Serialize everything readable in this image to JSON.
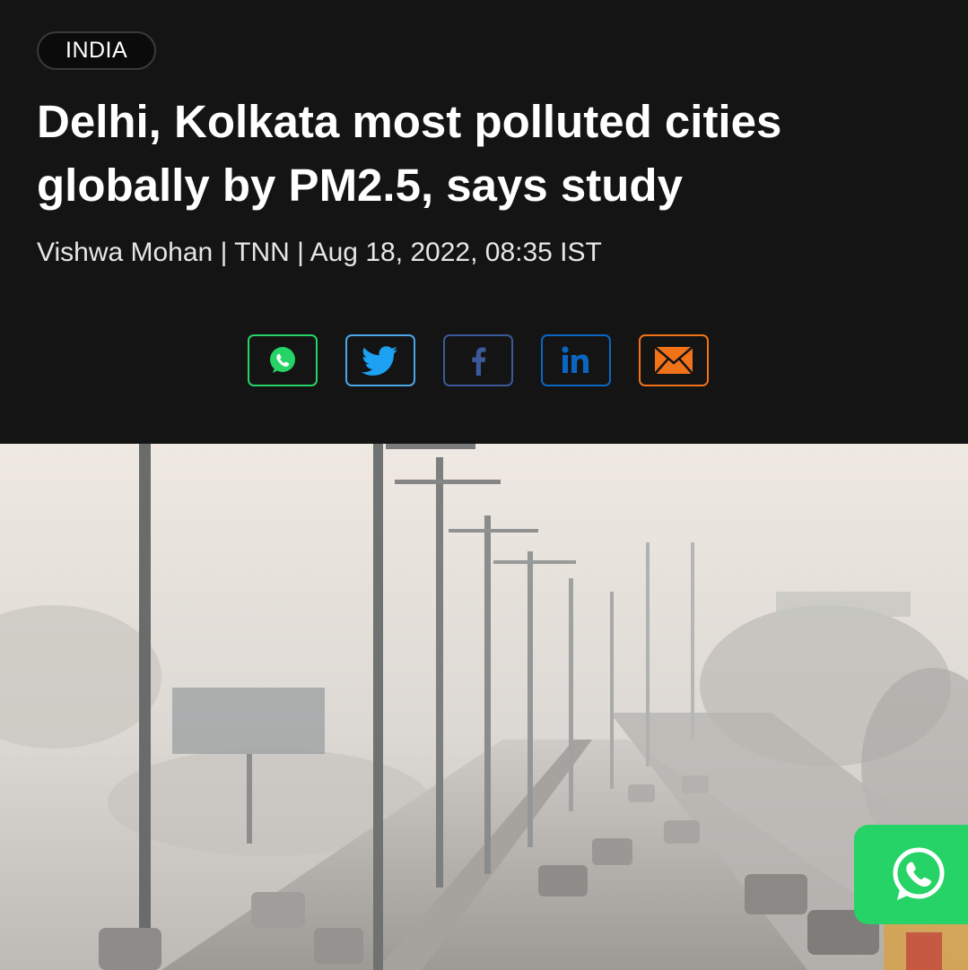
{
  "article": {
    "section": "INDIA",
    "headline": "Delhi, Kolkata most polluted cities globally by PM2.5, says study",
    "byline": "Vishwa Mohan | TNN | Aug 18, 2022, 08:35 IST"
  },
  "share": [
    {
      "name": "whatsapp",
      "icon": "whatsapp-icon",
      "color": "#25d366"
    },
    {
      "name": "twitter",
      "icon": "twitter-bird-icon",
      "color": "#4aa7e8"
    },
    {
      "name": "facebook",
      "icon": "facebook-icon",
      "color": "#3b5998"
    },
    {
      "name": "linkedin",
      "icon": "linkedin-icon",
      "color": "#0a66c2"
    },
    {
      "name": "email",
      "icon": "email-envelope-icon",
      "color": "#f07319"
    }
  ],
  "hero_image": {
    "subject": "smog-covered road with street lights and traffic",
    "colors": {
      "sky": "#ece7e1",
      "haze": "#cfcbc6",
      "road": "#9a9894"
    }
  },
  "floating_whatsapp": {
    "icon": "whatsapp-icon",
    "color": "#25d366"
  }
}
